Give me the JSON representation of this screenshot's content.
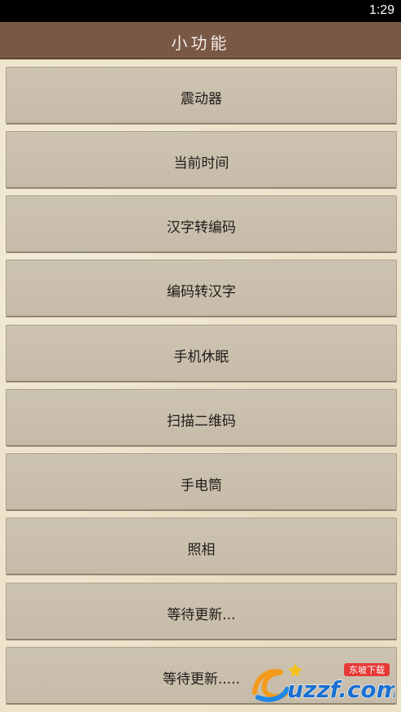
{
  "status_bar": {
    "time": "1:29"
  },
  "app_bar": {
    "title": "小功能"
  },
  "menu": {
    "items": [
      {
        "label": "震动器"
      },
      {
        "label": "当前时间"
      },
      {
        "label": "汉字转编码"
      },
      {
        "label": "编码转汉字"
      },
      {
        "label": "手机休眠"
      },
      {
        "label": "扫描二维码"
      },
      {
        "label": "手电筒"
      },
      {
        "label": "照相"
      },
      {
        "label": "等待更新..."
      },
      {
        "label": "等待更新....."
      }
    ]
  },
  "watermark": {
    "brand": "uzzf.com",
    "tagline": "东坡下载",
    "icon": "swirl-logo-icon"
  },
  "colors": {
    "app_bar": "#7a5846",
    "button": "#c6bba8",
    "background": "#eee4cb"
  }
}
